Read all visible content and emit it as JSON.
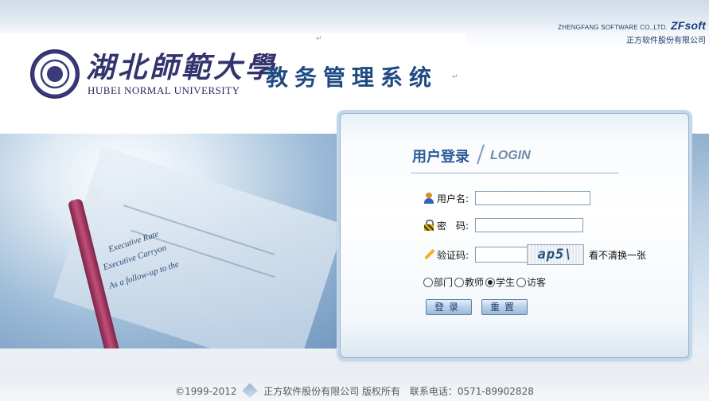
{
  "vendor": {
    "line1": "ZHENGFANG SOFTWARE CO.,LTD.",
    "brand": "ZFsoft",
    "line2": "正方软件股份有限公司"
  },
  "header": {
    "university_cn": "湖北師範大學",
    "university_en": "HUBEI NORMAL UNIVERSITY",
    "system_title": "教务管理系统",
    "return_mark": "↵"
  },
  "banner": {
    "doc_line1": "Executive Rate",
    "doc_line2": "Executive Carryon",
    "doc_line3": "As a follow-up to the"
  },
  "login": {
    "title": "用户登录",
    "title_en": "LOGIN",
    "username_label": "用户名:",
    "username_value": "",
    "password_label": "密　码:",
    "password_value": "",
    "captcha_label": "验证码:",
    "captcha_value": "",
    "captcha_text": "ap5\\",
    "refresh_label": "看不清换一张",
    "roles": [
      "部门",
      "教师",
      "学生",
      "访客"
    ],
    "selected_role": "学生",
    "login_button": "登录",
    "reset_button": "重置"
  },
  "footer": {
    "copyright": "©1999-2012",
    "company": "正方软件股份有限公司 版权所有",
    "phone": "联系电话：0571-89902828"
  },
  "colors": {
    "accent": "#2a5a98",
    "title_blue": "#1f4b82",
    "university_purple": "#33336e"
  }
}
